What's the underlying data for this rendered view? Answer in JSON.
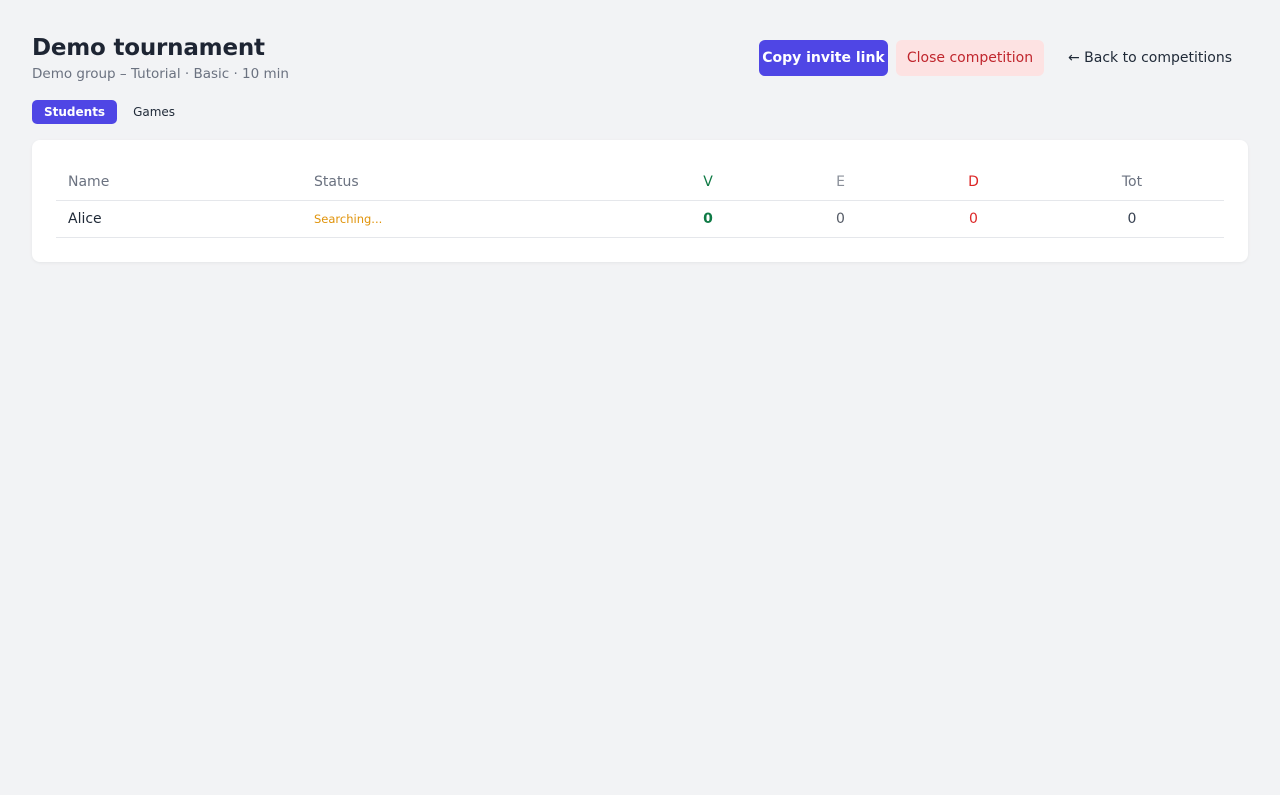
{
  "header": {
    "title": "Demo tournament",
    "subtitle": "Demo group – Tutorial · Basic · 10 min"
  },
  "actions": {
    "copy_invite": "Copy invite link",
    "close_competition": "Close competition",
    "back": "← Back to competitions"
  },
  "tabs": [
    {
      "label": "Students",
      "active": true
    },
    {
      "label": "Games",
      "active": false
    }
  ],
  "table": {
    "columns": {
      "name": "Name",
      "status": "Status",
      "v": "V",
      "e": "E",
      "d": "D",
      "tot": "Tot"
    },
    "rows": [
      {
        "name": "Alice",
        "status": "Searching...",
        "v": "0",
        "e": "0",
        "d": "0",
        "tot": "0"
      }
    ]
  },
  "colors": {
    "primary": "#4f46e5",
    "danger_bg": "#fde2e2",
    "danger_text": "#c0262d",
    "status_searching": "#e0930a",
    "win": "#0f7a45",
    "draw": "#8a8f99",
    "loss": "#dc2626"
  }
}
